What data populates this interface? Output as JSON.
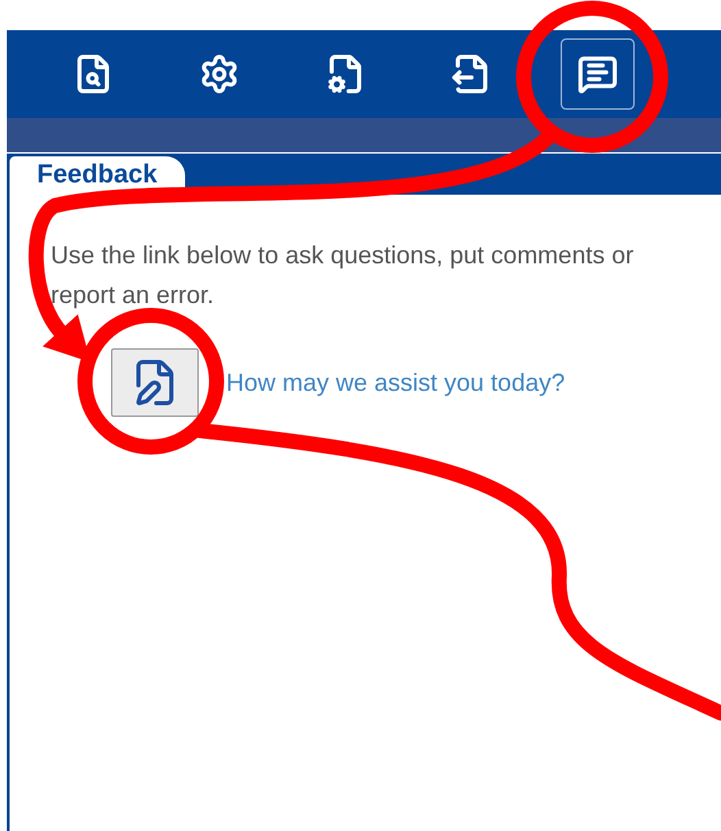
{
  "toolbar": [
    {
      "kind": "search",
      "selected": false
    },
    {
      "kind": "settings",
      "selected": false
    },
    {
      "kind": "file-settings",
      "selected": false
    },
    {
      "kind": "export",
      "selected": false
    },
    {
      "kind": "feedback",
      "selected": true
    }
  ],
  "tabs": [
    {
      "label": "Feedback",
      "selected": true
    }
  ],
  "panel": {
    "description": "Use the link below to ask questions, put comments or report an error.",
    "link": "How may we assist you today?"
  }
}
